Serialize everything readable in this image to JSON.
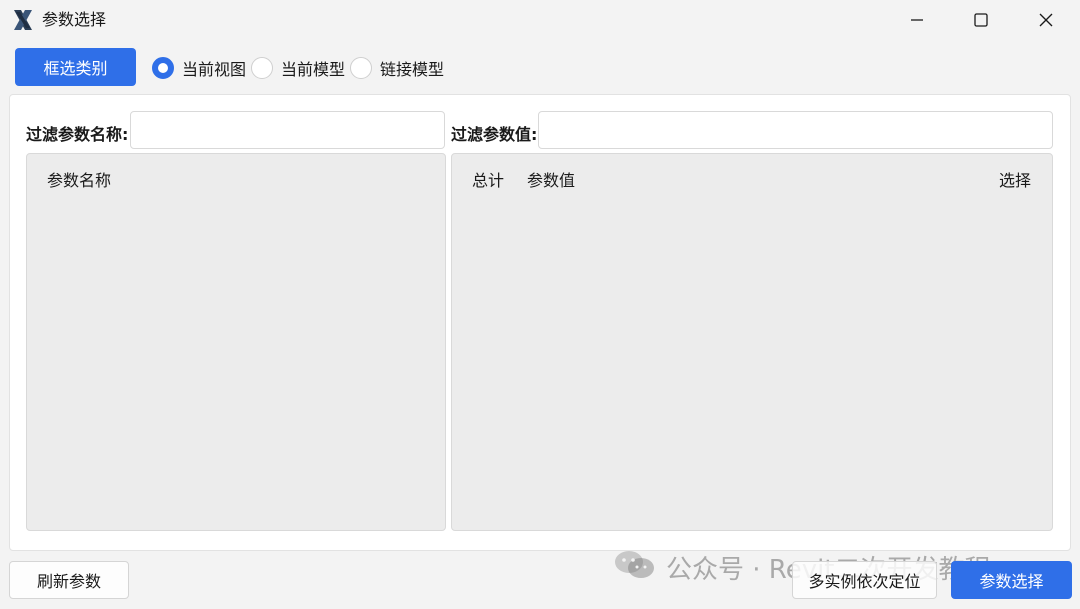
{
  "window": {
    "title": "参数选择",
    "logo": "x-logo-icon"
  },
  "toolbar": {
    "select_category_label": "框选类别",
    "scope_options": [
      {
        "label": "当前视图",
        "checked": true
      },
      {
        "label": "当前模型",
        "checked": false
      },
      {
        "label": "链接模型",
        "checked": false
      }
    ]
  },
  "filters": {
    "name_label": "过滤参数名称:",
    "name_value": "",
    "value_label": "过滤参数值:",
    "value_value": ""
  },
  "name_list": {
    "column": "参数名称"
  },
  "value_list": {
    "columns": {
      "total": "总计",
      "value": "参数值",
      "select": "选择"
    }
  },
  "footer": {
    "refresh_label": "刷新参数",
    "locate_label": "多实例依次定位",
    "select_label": "参数选择"
  },
  "watermark": "公众号 · Revit二次开发教程",
  "colors": {
    "accent": "#2f6fe8",
    "list_bg": "#ececec",
    "window_bg": "#f3f3f3"
  }
}
